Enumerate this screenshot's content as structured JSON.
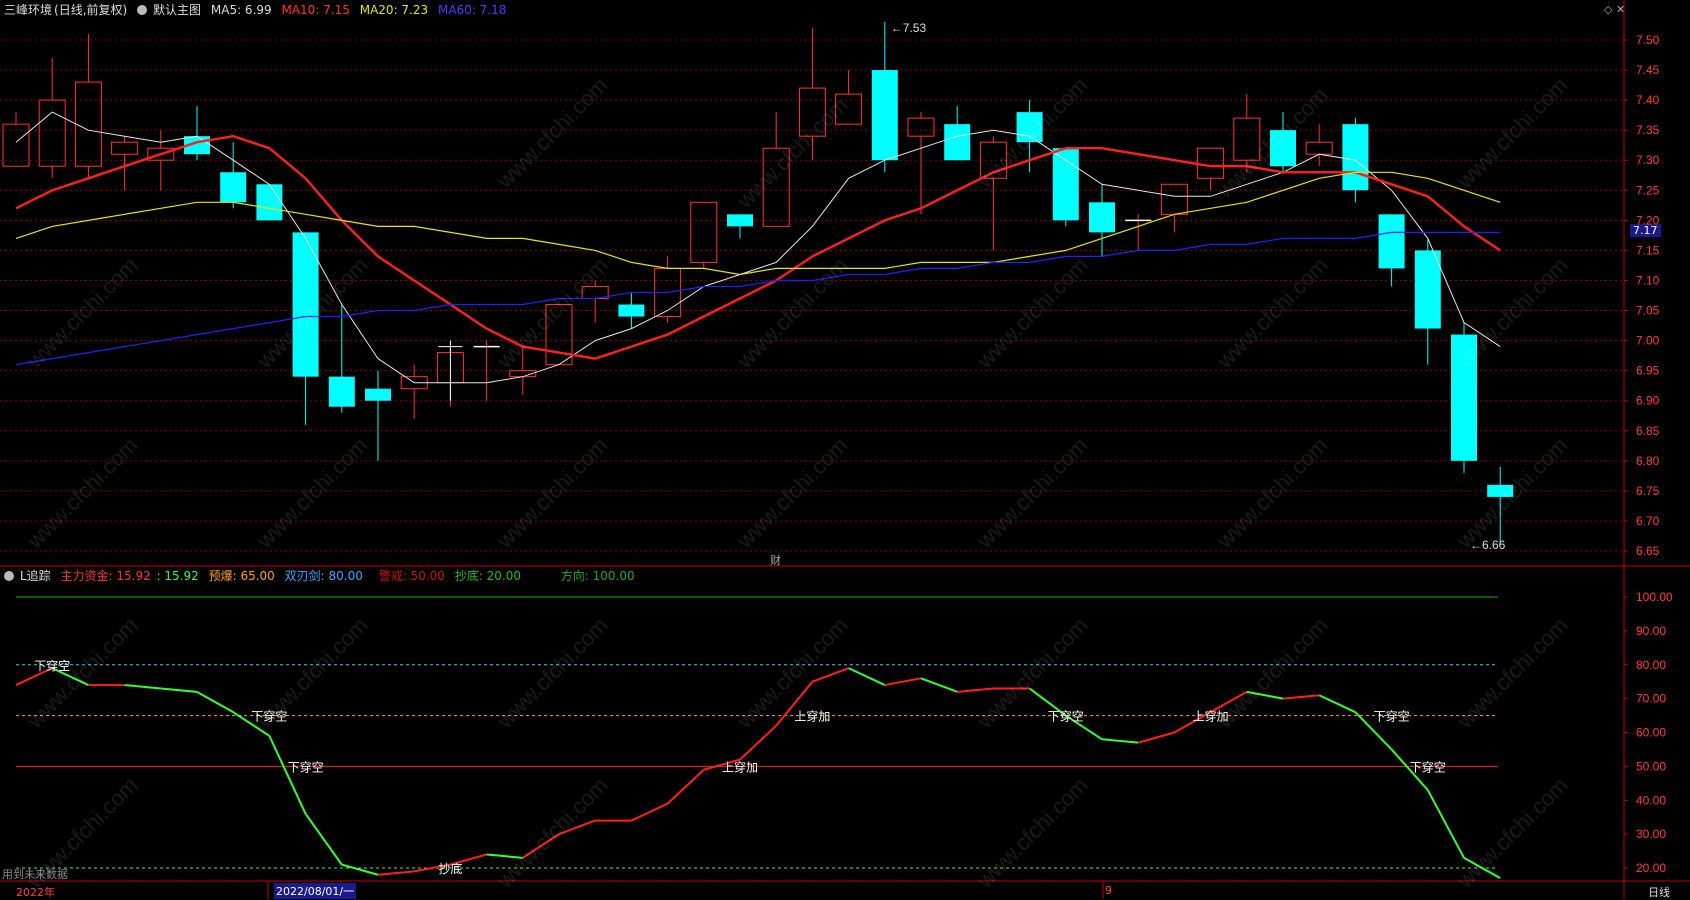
{
  "header_main": {
    "stock_name": "三峰环境",
    "period": "(日线,前复权)",
    "main_chart": "默认主图",
    "ma5_label": "MA5: 6.99",
    "ma10_label": "MA10: 7.15",
    "ma20_label": "MA20: 7.23",
    "ma60_label": "MA60: 7.18"
  },
  "header_sub": {
    "indicator": "L追踪",
    "l1": "主力资金: 15.92",
    "l2": ": 15.92",
    "l3": "预爆: 65.00",
    "l4": "双刃剑: 80.00",
    "l5": "警戒: 50.00",
    "l6": "抄底: 20.00",
    "l7": "方向: 100.00"
  },
  "colors": {
    "up": "#ff3232",
    "down": "#00ffff",
    "ma5": "#e6e6e6",
    "ma10": "#ff2020",
    "ma20": "#e6e600",
    "ma60": "#2020ff",
    "grid": "#8b0000",
    "axis": "#c00000",
    "green": "#33ff33",
    "cyanline": "#33ccff",
    "orange": "#ffa500"
  },
  "footer": {
    "year_label": "2022年",
    "date_label": "2022/08/01/一",
    "month_label": "9",
    "period_label": "日线",
    "future_note": "用到未来数据"
  },
  "badge_finance": "财",
  "cur_price_label": "7.17",
  "chart_data": [
    {
      "type": "candlestick",
      "yaxis_ticks": [
        "7.50",
        "7.45",
        "7.40",
        "7.35",
        "7.30",
        "7.25",
        "7.20",
        "7.15",
        "7.10",
        "7.05",
        "7.00",
        "6.95",
        "6.90",
        "6.85",
        "6.80",
        "6.75",
        "6.70",
        "6.65"
      ],
      "ylim": [
        6.63,
        7.54
      ],
      "annotations": [
        {
          "text": "7.53",
          "index": 24,
          "value": 7.53
        },
        {
          "text": "6.66",
          "index": 40,
          "value": 6.66
        }
      ],
      "candles": [
        {
          "o": 7.29,
          "c": 7.36,
          "h": 7.38,
          "l": 7.29
        },
        {
          "o": 7.29,
          "c": 7.4,
          "h": 7.47,
          "l": 7.27
        },
        {
          "o": 7.29,
          "c": 7.43,
          "h": 7.51,
          "l": 7.27
        },
        {
          "o": 7.31,
          "c": 7.33,
          "h": 7.34,
          "l": 7.25
        },
        {
          "o": 7.3,
          "c": 7.32,
          "h": 7.35,
          "l": 7.25
        },
        {
          "o": 7.34,
          "c": 7.31,
          "h": 7.39,
          "l": 7.3
        },
        {
          "o": 7.28,
          "c": 7.23,
          "h": 7.33,
          "l": 7.22
        },
        {
          "o": 7.26,
          "c": 7.2,
          "h": 7.26,
          "l": 7.2
        },
        {
          "o": 7.18,
          "c": 6.94,
          "h": 7.18,
          "l": 6.86
        },
        {
          "o": 6.94,
          "c": 6.89,
          "h": 7.06,
          "l": 6.88
        },
        {
          "o": 6.92,
          "c": 6.9,
          "h": 6.95,
          "l": 6.8
        },
        {
          "o": 6.92,
          "c": 6.94,
          "h": 6.96,
          "l": 6.87
        },
        {
          "o": 6.93,
          "c": 6.98,
          "h": 6.99,
          "l": 6.89
        },
        {
          "o": 6.99,
          "c": 6.99,
          "h": 7.0,
          "l": 6.9
        },
        {
          "o": 6.94,
          "c": 6.95,
          "h": 6.99,
          "l": 6.91
        },
        {
          "o": 6.96,
          "c": 7.06,
          "h": 7.06,
          "l": 6.96
        },
        {
          "o": 7.07,
          "c": 7.09,
          "h": 7.1,
          "l": 7.03
        },
        {
          "o": 7.06,
          "c": 7.04,
          "h": 7.08,
          "l": 7.02
        },
        {
          "o": 7.04,
          "c": 7.12,
          "h": 7.14,
          "l": 7.03
        },
        {
          "o": 7.13,
          "c": 7.23,
          "h": 7.23,
          "l": 7.12
        },
        {
          "o": 7.21,
          "c": 7.19,
          "h": 7.21,
          "l": 7.17
        },
        {
          "o": 7.19,
          "c": 7.32,
          "h": 7.38,
          "l": 7.19
        },
        {
          "o": 7.34,
          "c": 7.42,
          "h": 7.52,
          "l": 7.3
        },
        {
          "o": 7.36,
          "c": 7.41,
          "h": 7.45,
          "l": 7.36
        },
        {
          "o": 7.45,
          "c": 7.3,
          "h": 7.53,
          "l": 7.28
        },
        {
          "o": 7.34,
          "c": 7.37,
          "h": 7.38,
          "l": 7.21
        },
        {
          "o": 7.36,
          "c": 7.3,
          "h": 7.39,
          "l": 7.3
        },
        {
          "o": 7.27,
          "c": 7.33,
          "h": 7.34,
          "l": 7.15
        },
        {
          "o": 7.38,
          "c": 7.33,
          "h": 7.4,
          "l": 7.28
        },
        {
          "o": 7.32,
          "c": 7.2,
          "h": 7.32,
          "l": 7.19
        },
        {
          "o": 7.23,
          "c": 7.18,
          "h": 7.26,
          "l": 7.14
        },
        {
          "o": 7.2,
          "c": 7.2,
          "h": 7.21,
          "l": 7.15
        },
        {
          "o": 7.21,
          "c": 7.26,
          "h": 7.26,
          "l": 7.18
        },
        {
          "o": 7.27,
          "c": 7.32,
          "h": 7.32,
          "l": 7.25
        },
        {
          "o": 7.3,
          "c": 7.37,
          "h": 7.41,
          "l": 7.28
        },
        {
          "o": 7.35,
          "c": 7.29,
          "h": 7.38,
          "l": 7.28
        },
        {
          "o": 7.31,
          "c": 7.33,
          "h": 7.36,
          "l": 7.29
        },
        {
          "o": 7.36,
          "c": 7.25,
          "h": 7.37,
          "l": 7.23
        },
        {
          "o": 7.21,
          "c": 7.12,
          "h": 7.21,
          "l": 7.09
        },
        {
          "o": 7.15,
          "c": 7.02,
          "h": 7.17,
          "l": 6.96
        },
        {
          "o": 7.01,
          "c": 6.8,
          "h": 7.03,
          "l": 6.78
        },
        {
          "o": 6.76,
          "c": 6.74,
          "h": 6.79,
          "l": 6.66
        }
      ],
      "series": [
        {
          "name": "MA5",
          "values": [
            7.33,
            7.38,
            7.35,
            7.34,
            7.33,
            7.34,
            7.3,
            7.26,
            7.17,
            7.06,
            6.97,
            6.93,
            6.93,
            6.93,
            6.94,
            6.96,
            7.0,
            7.02,
            7.05,
            7.09,
            7.11,
            7.13,
            7.19,
            7.27,
            7.3,
            7.32,
            7.34,
            7.35,
            7.34,
            7.3,
            7.26,
            7.25,
            7.24,
            7.24,
            7.26,
            7.28,
            7.31,
            7.3,
            7.25,
            7.17,
            7.03,
            6.99
          ]
        },
        {
          "name": "MA10",
          "values": [
            7.22,
            7.25,
            7.27,
            7.29,
            7.31,
            7.33,
            7.34,
            7.32,
            7.27,
            7.2,
            7.14,
            7.1,
            7.06,
            7.02,
            6.99,
            6.98,
            6.97,
            6.99,
            7.01,
            7.04,
            7.07,
            7.1,
            7.14,
            7.17,
            7.2,
            7.22,
            7.25,
            7.28,
            7.3,
            7.32,
            7.32,
            7.31,
            7.3,
            7.29,
            7.29,
            7.28,
            7.28,
            7.28,
            7.26,
            7.24,
            7.19,
            7.15
          ]
        },
        {
          "name": "MA20",
          "values": [
            7.17,
            7.19,
            7.2,
            7.21,
            7.22,
            7.23,
            7.23,
            7.22,
            7.21,
            7.2,
            7.19,
            7.19,
            7.18,
            7.17,
            7.17,
            7.16,
            7.15,
            7.13,
            7.12,
            7.12,
            7.11,
            7.12,
            7.12,
            7.12,
            7.12,
            7.13,
            7.13,
            7.13,
            7.14,
            7.15,
            7.17,
            7.19,
            7.21,
            7.22,
            7.23,
            7.25,
            7.27,
            7.28,
            7.28,
            7.27,
            7.25,
            7.23
          ]
        },
        {
          "name": "MA60",
          "values": [
            6.96,
            6.97,
            6.98,
            6.99,
            7.0,
            7.01,
            7.02,
            7.03,
            7.04,
            7.04,
            7.05,
            7.05,
            7.06,
            7.06,
            7.06,
            7.07,
            7.07,
            7.08,
            7.08,
            7.09,
            7.09,
            7.1,
            7.1,
            7.11,
            7.11,
            7.12,
            7.12,
            7.13,
            7.13,
            7.14,
            7.14,
            7.15,
            7.15,
            7.16,
            7.16,
            7.17,
            7.17,
            7.17,
            7.18,
            7.18,
            7.18,
            7.18
          ]
        }
      ]
    },
    {
      "type": "line",
      "yaxis_ticks": [
        "100.00",
        "90.00",
        "80.00",
        "70.00",
        "60.00",
        "50.00",
        "40.00",
        "30.00",
        "20.00"
      ],
      "ylim": [
        15,
        103
      ],
      "reference_lines": [
        {
          "value": 100,
          "color": "#22aa22"
        },
        {
          "value": 80,
          "color": "#33ccff",
          "dashed": true
        },
        {
          "value": 65,
          "color": "#ffa500",
          "dashed": true
        },
        {
          "value": 50,
          "color": "#ff2020"
        },
        {
          "value": 20,
          "color": "#33ff33",
          "dashed": true
        }
      ],
      "series": [
        {
          "values": [
            74,
            79,
            74,
            74,
            73,
            72,
            66,
            59,
            36,
            21,
            18,
            19,
            21,
            24,
            23,
            30,
            34,
            34,
            39,
            49,
            52,
            62,
            75,
            79,
            74,
            76,
            72,
            73,
            73,
            65,
            58,
            57,
            60,
            66,
            72,
            70,
            71,
            66,
            55,
            43,
            23,
            17
          ]
        }
      ],
      "labels": [
        {
          "text": "下穿空",
          "index": 1,
          "value": 80
        },
        {
          "text": "下穿空",
          "index": 7,
          "value": 65
        },
        {
          "text": "下穿空",
          "index": 8,
          "value": 50
        },
        {
          "text": "抄底",
          "index": 12,
          "value": 20
        },
        {
          "text": "上穿加",
          "index": 20,
          "value": 50
        },
        {
          "text": "上穿加",
          "index": 22,
          "value": 65
        },
        {
          "text": "下穿空",
          "index": 29,
          "value": 65
        },
        {
          "text": "上穿加",
          "index": 33,
          "value": 65
        },
        {
          "text": "下穿空",
          "index": 38,
          "value": 65
        },
        {
          "text": "下穿空",
          "index": 39,
          "value": 50
        }
      ]
    }
  ]
}
